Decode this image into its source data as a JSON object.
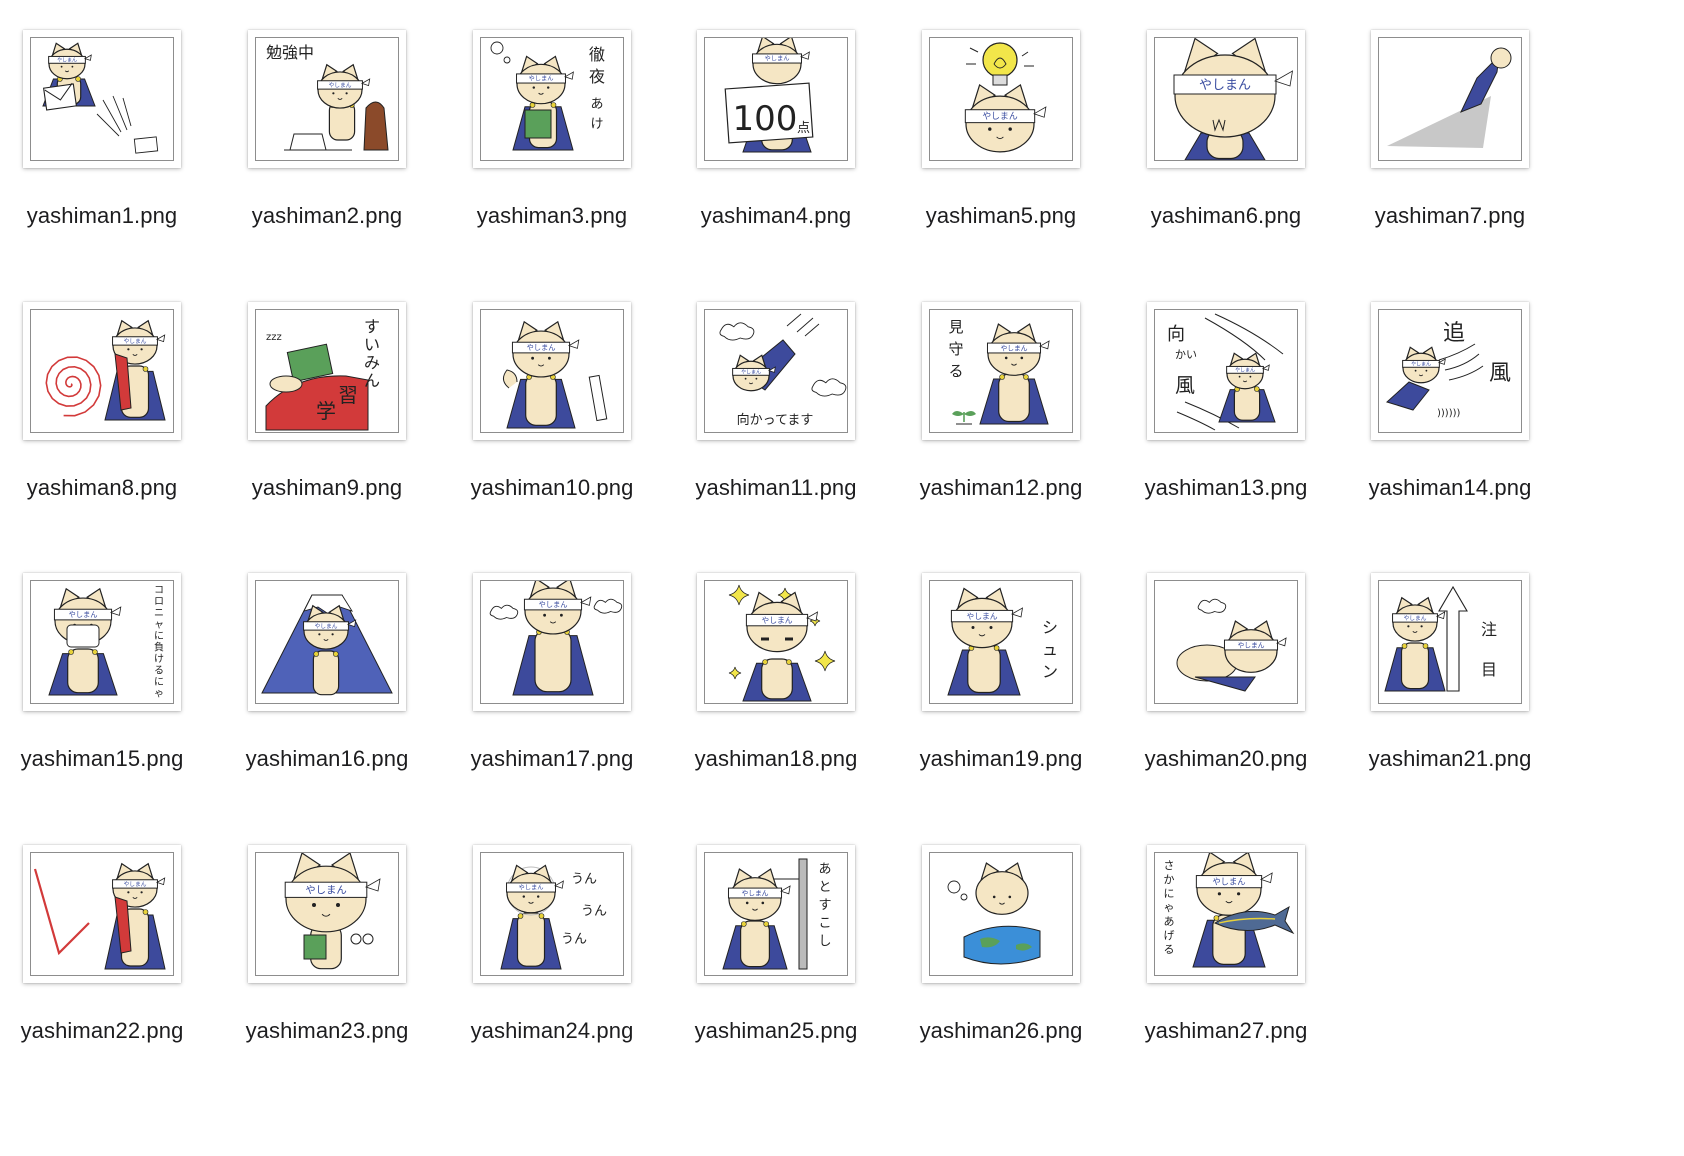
{
  "files": [
    {
      "name": "yashiman1.png",
      "variant": "envelope"
    },
    {
      "name": "yashiman2.png",
      "variant": "study",
      "caption": "勉強中"
    },
    {
      "name": "yashiman3.png",
      "variant": "book",
      "caption": "徹夜あけ"
    },
    {
      "name": "yashiman4.png",
      "variant": "score",
      "caption": "100点"
    },
    {
      "name": "yashiman5.png",
      "variant": "bulb"
    },
    {
      "name": "yashiman6.png",
      "variant": "bigface"
    },
    {
      "name": "yashiman7.png",
      "variant": "flying"
    },
    {
      "name": "yashiman8.png",
      "variant": "spiral"
    },
    {
      "name": "yashiman9.png",
      "variant": "sleep",
      "caption": "すいみん学習"
    },
    {
      "name": "yashiman10.png",
      "variant": "muscle"
    },
    {
      "name": "yashiman11.png",
      "variant": "sky",
      "caption": "向かってます"
    },
    {
      "name": "yashiman12.png",
      "variant": "sprout",
      "caption": "見守る"
    },
    {
      "name": "yashiman13.png",
      "variant": "wind",
      "caption": "向かい風"
    },
    {
      "name": "yashiman14.png",
      "variant": "tailwind",
      "caption": "追風"
    },
    {
      "name": "yashiman15.png",
      "variant": "mask",
      "caption": "コロニャに負けるにゃ"
    },
    {
      "name": "yashiman16.png",
      "variant": "mountain"
    },
    {
      "name": "yashiman17.png",
      "variant": "steam"
    },
    {
      "name": "yashiman18.png",
      "variant": "sparkle"
    },
    {
      "name": "yashiman19.png",
      "variant": "shun",
      "caption": "シュン"
    },
    {
      "name": "yashiman20.png",
      "variant": "lying"
    },
    {
      "name": "yashiman21.png",
      "variant": "arrow",
      "caption": "注目"
    },
    {
      "name": "yashiman22.png",
      "variant": "check"
    },
    {
      "name": "yashiman23.png",
      "variant": "glasses"
    },
    {
      "name": "yashiman24.png",
      "variant": "nod",
      "caption": "うんうんうん"
    },
    {
      "name": "yashiman25.png",
      "variant": "wall",
      "caption": "あとすこし"
    },
    {
      "name": "yashiman26.png",
      "variant": "globe"
    },
    {
      "name": "yashiman27.png",
      "variant": "fish",
      "caption": "さかにゃあげる"
    }
  ],
  "headband_text": "やしまん",
  "colors": {
    "cat_body": "#f5e6c4",
    "cape": "#3d4a9c",
    "headband_text": "#3a4da0",
    "ink": "#222222",
    "red": "#d23a3a",
    "green": "#5aa05a",
    "bulb_yellow": "#f2e64a",
    "gold": "#e8d23a"
  }
}
